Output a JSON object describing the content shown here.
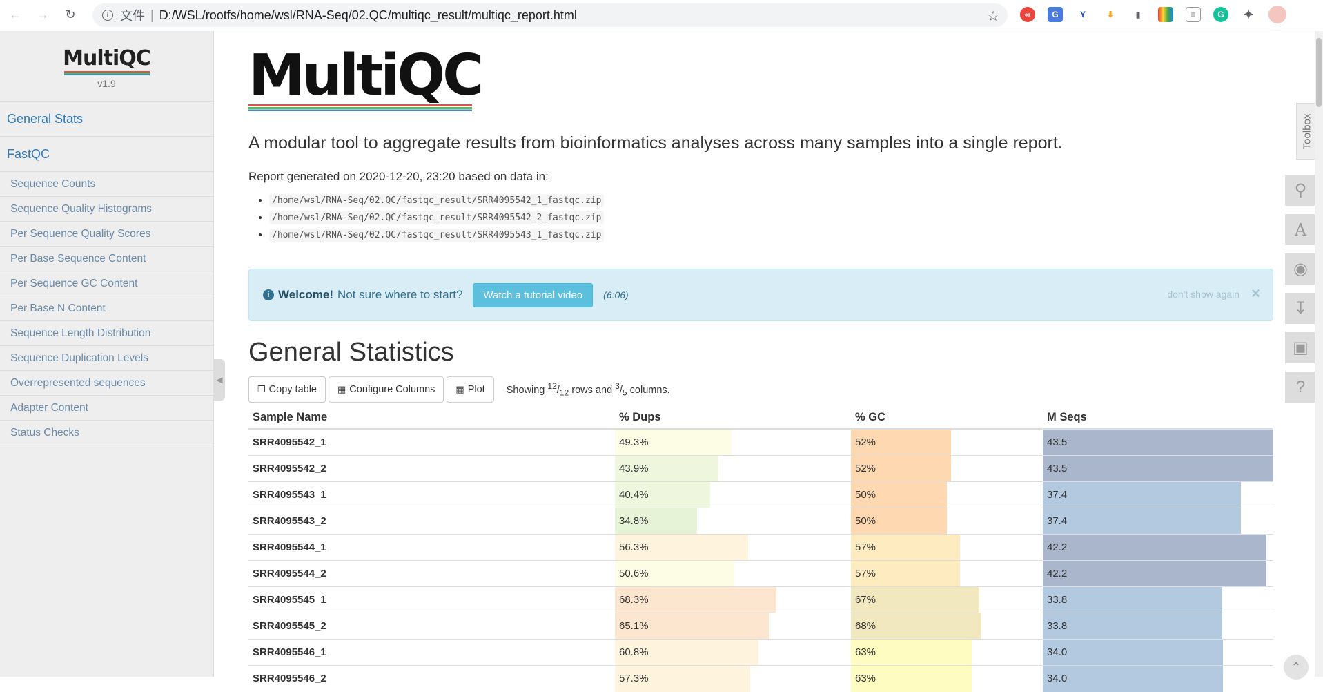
{
  "browser": {
    "scheme_label": "文件",
    "url": "D:/WSL/rootfs/home/wsl/RNA-Seq/02.QC/multiqc_result/multiqc_report.html",
    "extensions": [
      "glasses-extension-icon",
      "translate-extension-icon",
      "y-extension-icon",
      "download-extension-icon",
      "bookmark-extension-icon",
      "colors-extension-icon",
      "doc-extension-icon",
      "grammarly-extension-icon",
      "puzzle-icon",
      "profile-avatar"
    ]
  },
  "sidebar": {
    "logo": "MultiQC",
    "version": "v1.9",
    "main_links": [
      "General Stats",
      "FastQC"
    ],
    "fastqc_items": [
      "Sequence Counts",
      "Sequence Quality Histograms",
      "Per Sequence Quality Scores",
      "Per Base Sequence Content",
      "Per Sequence GC Content",
      "Per Base N Content",
      "Sequence Length Distribution",
      "Sequence Duplication Levels",
      "Overrepresented sequences",
      "Adapter Content",
      "Status Checks"
    ]
  },
  "header": {
    "logo": "MultiQC",
    "lead": "A modular tool to aggregate results from bioinformatics analyses across many samples into a single report.",
    "report_generated": "Report generated on 2020-12-20, 23:20 based on data in:",
    "files": [
      "/home/wsl/RNA-Seq/02.QC/fastqc_result/SRR4095542_1_fastqc.zip",
      "/home/wsl/RNA-Seq/02.QC/fastqc_result/SRR4095542_2_fastqc.zip",
      "/home/wsl/RNA-Seq/02.QC/fastqc_result/SRR4095543_1_fastqc.zip"
    ]
  },
  "welcome": {
    "strong": "Welcome!",
    "text": "Not sure where to start?",
    "button": "Watch a tutorial video",
    "duration": "(6:06)",
    "dont_show": "don't show again",
    "close": "×"
  },
  "general_stats": {
    "title": "General Statistics",
    "copy_table": "Copy table",
    "configure_columns": "Configure Columns",
    "plot": "Plot",
    "showing_prefix": "Showing ",
    "rows_shown": "12",
    "rows_total": "12",
    "rows_word": " rows and ",
    "cols_shown": "3",
    "cols_total": "5",
    "cols_word": " columns.",
    "columns": [
      "Sample Name",
      "% Dups",
      "% GC",
      "M Seqs"
    ],
    "rows": [
      {
        "sample": "SRR4095542_1",
        "dups": "49.3%",
        "dups_v": 49.3,
        "gc": "52%",
        "gc_v": 52,
        "mseqs": "43.5",
        "mseqs_v": 43.5
      },
      {
        "sample": "SRR4095542_2",
        "dups": "43.9%",
        "dups_v": 43.9,
        "gc": "52%",
        "gc_v": 52,
        "mseqs": "43.5",
        "mseqs_v": 43.5
      },
      {
        "sample": "SRR4095543_1",
        "dups": "40.4%",
        "dups_v": 40.4,
        "gc": "50%",
        "gc_v": 50,
        "mseqs": "37.4",
        "mseqs_v": 37.4
      },
      {
        "sample": "SRR4095543_2",
        "dups": "34.8%",
        "dups_v": 34.8,
        "gc": "50%",
        "gc_v": 50,
        "mseqs": "37.4",
        "mseqs_v": 37.4
      },
      {
        "sample": "SRR4095544_1",
        "dups": "56.3%",
        "dups_v": 56.3,
        "gc": "57%",
        "gc_v": 57,
        "mseqs": "42.2",
        "mseqs_v": 42.2
      },
      {
        "sample": "SRR4095544_2",
        "dups": "50.6%",
        "dups_v": 50.6,
        "gc": "57%",
        "gc_v": 57,
        "mseqs": "42.2",
        "mseqs_v": 42.2
      },
      {
        "sample": "SRR4095545_1",
        "dups": "68.3%",
        "dups_v": 68.3,
        "gc": "67%",
        "gc_v": 67,
        "mseqs": "33.8",
        "mseqs_v": 33.8
      },
      {
        "sample": "SRR4095545_2",
        "dups": "65.1%",
        "dups_v": 65.1,
        "gc": "68%",
        "gc_v": 68,
        "mseqs": "33.8",
        "mseqs_v": 33.8
      },
      {
        "sample": "SRR4095546_1",
        "dups": "60.8%",
        "dups_v": 60.8,
        "gc": "63%",
        "gc_v": 63,
        "mseqs": "34.0",
        "mseqs_v": 34.0
      },
      {
        "sample": "SRR4095546_2",
        "dups": "57.3%",
        "dups_v": 57.3,
        "gc": "63%",
        "gc_v": 63,
        "mseqs": "34.0",
        "mseqs_v": 34.0
      }
    ]
  },
  "toolbox": {
    "label": "Toolbox",
    "buttons": [
      "pin-icon",
      "font-icon",
      "hide-icon",
      "download-icon",
      "save-icon",
      "help-icon"
    ]
  },
  "colors": {
    "link": "#337ab7",
    "welcome_bg": "#d9edf7",
    "tutorial_button": "#5bc0de"
  }
}
